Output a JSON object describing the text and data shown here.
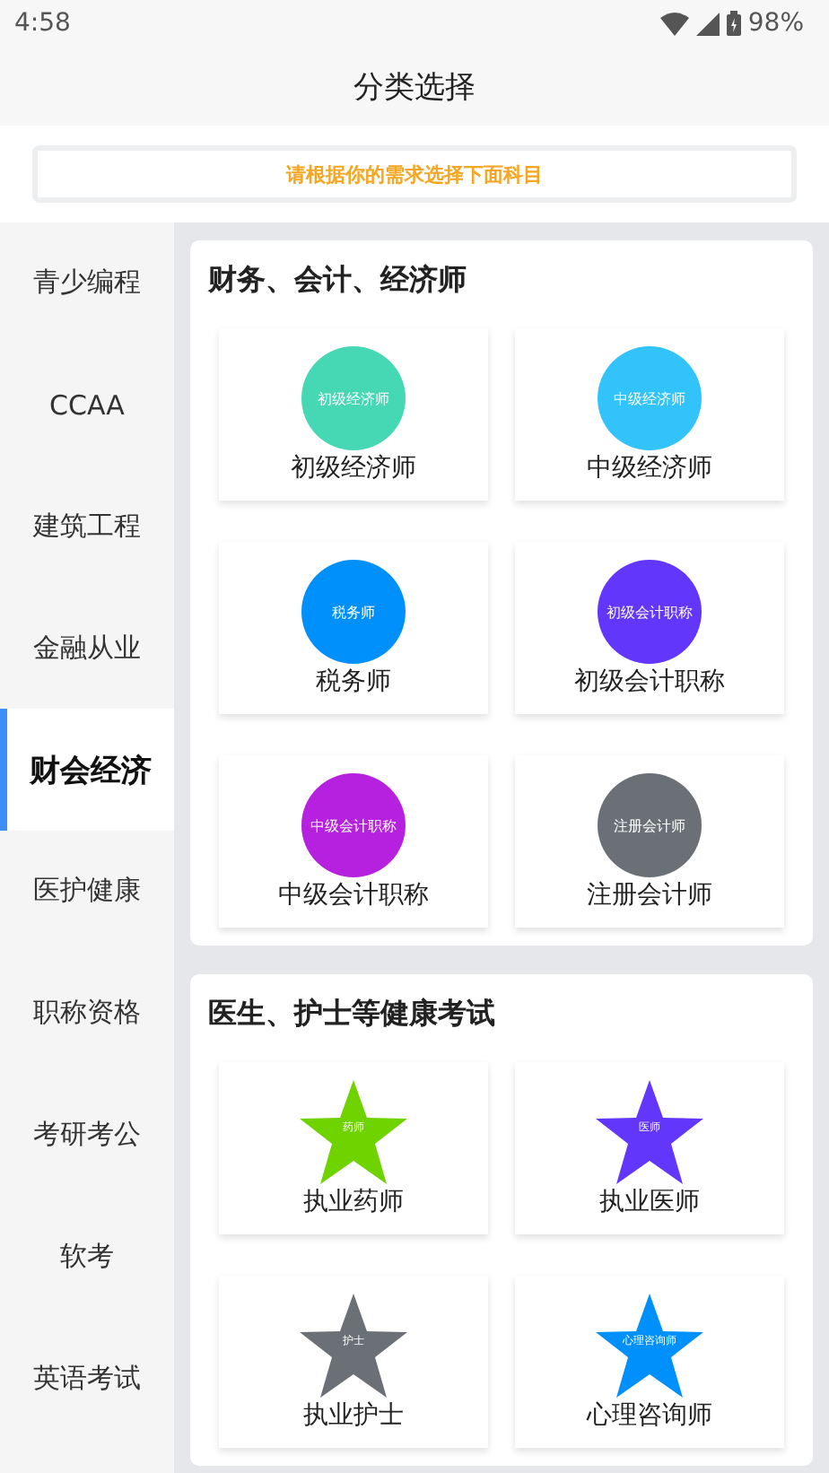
{
  "status_bar": {
    "time": "4:58",
    "battery": "98%"
  },
  "title": "分类选择",
  "notice": "请根据你的需求选择下面科目",
  "sidebar": {
    "items": [
      {
        "label": "青少编程",
        "selected": false
      },
      {
        "label": "CCAA",
        "selected": false
      },
      {
        "label": "建筑工程",
        "selected": false
      },
      {
        "label": "金融从业",
        "selected": false
      },
      {
        "label": "财会经济",
        "selected": true
      },
      {
        "label": "医护健康",
        "selected": false
      },
      {
        "label": "职称资格",
        "selected": false
      },
      {
        "label": "考研考公",
        "selected": false
      },
      {
        "label": "软考",
        "selected": false
      },
      {
        "label": "英语考试",
        "selected": false
      }
    ]
  },
  "sections": [
    {
      "title": "财务、会计、经济师",
      "items": [
        {
          "label": "初级经济师",
          "logo_text": "初级经济师",
          "kind": "circle",
          "color": "#46d8b4"
        },
        {
          "label": "中级经济师",
          "logo_text": "中级经济师",
          "kind": "circle",
          "color": "#33c3fb"
        },
        {
          "label": "税务师",
          "logo_text": "税务师",
          "kind": "circle",
          "color": "#0090fb"
        },
        {
          "label": "初级会计职称",
          "logo_text": "初级会计职称",
          "kind": "circle",
          "color": "#6236fb"
        },
        {
          "label": "中级会计职称",
          "logo_text": "中级会计职称",
          "kind": "circle",
          "color": "#b621df"
        },
        {
          "label": "注册会计师",
          "logo_text": "注册会计师",
          "kind": "circle",
          "color": "#6b7077"
        }
      ]
    },
    {
      "title": "医生、护士等健康考试",
      "items": [
        {
          "label": "执业药师",
          "logo_text": "药师",
          "kind": "star",
          "color": "#6fd300"
        },
        {
          "label": "执业医师",
          "logo_text": "医师",
          "kind": "star",
          "color": "#6236fb"
        },
        {
          "label": "执业护士",
          "logo_text": "护士",
          "kind": "star",
          "color": "#6b7077"
        },
        {
          "label": "心理咨询师",
          "logo_text": "心理咨询师",
          "kind": "star",
          "color": "#0090fb"
        }
      ]
    }
  ]
}
